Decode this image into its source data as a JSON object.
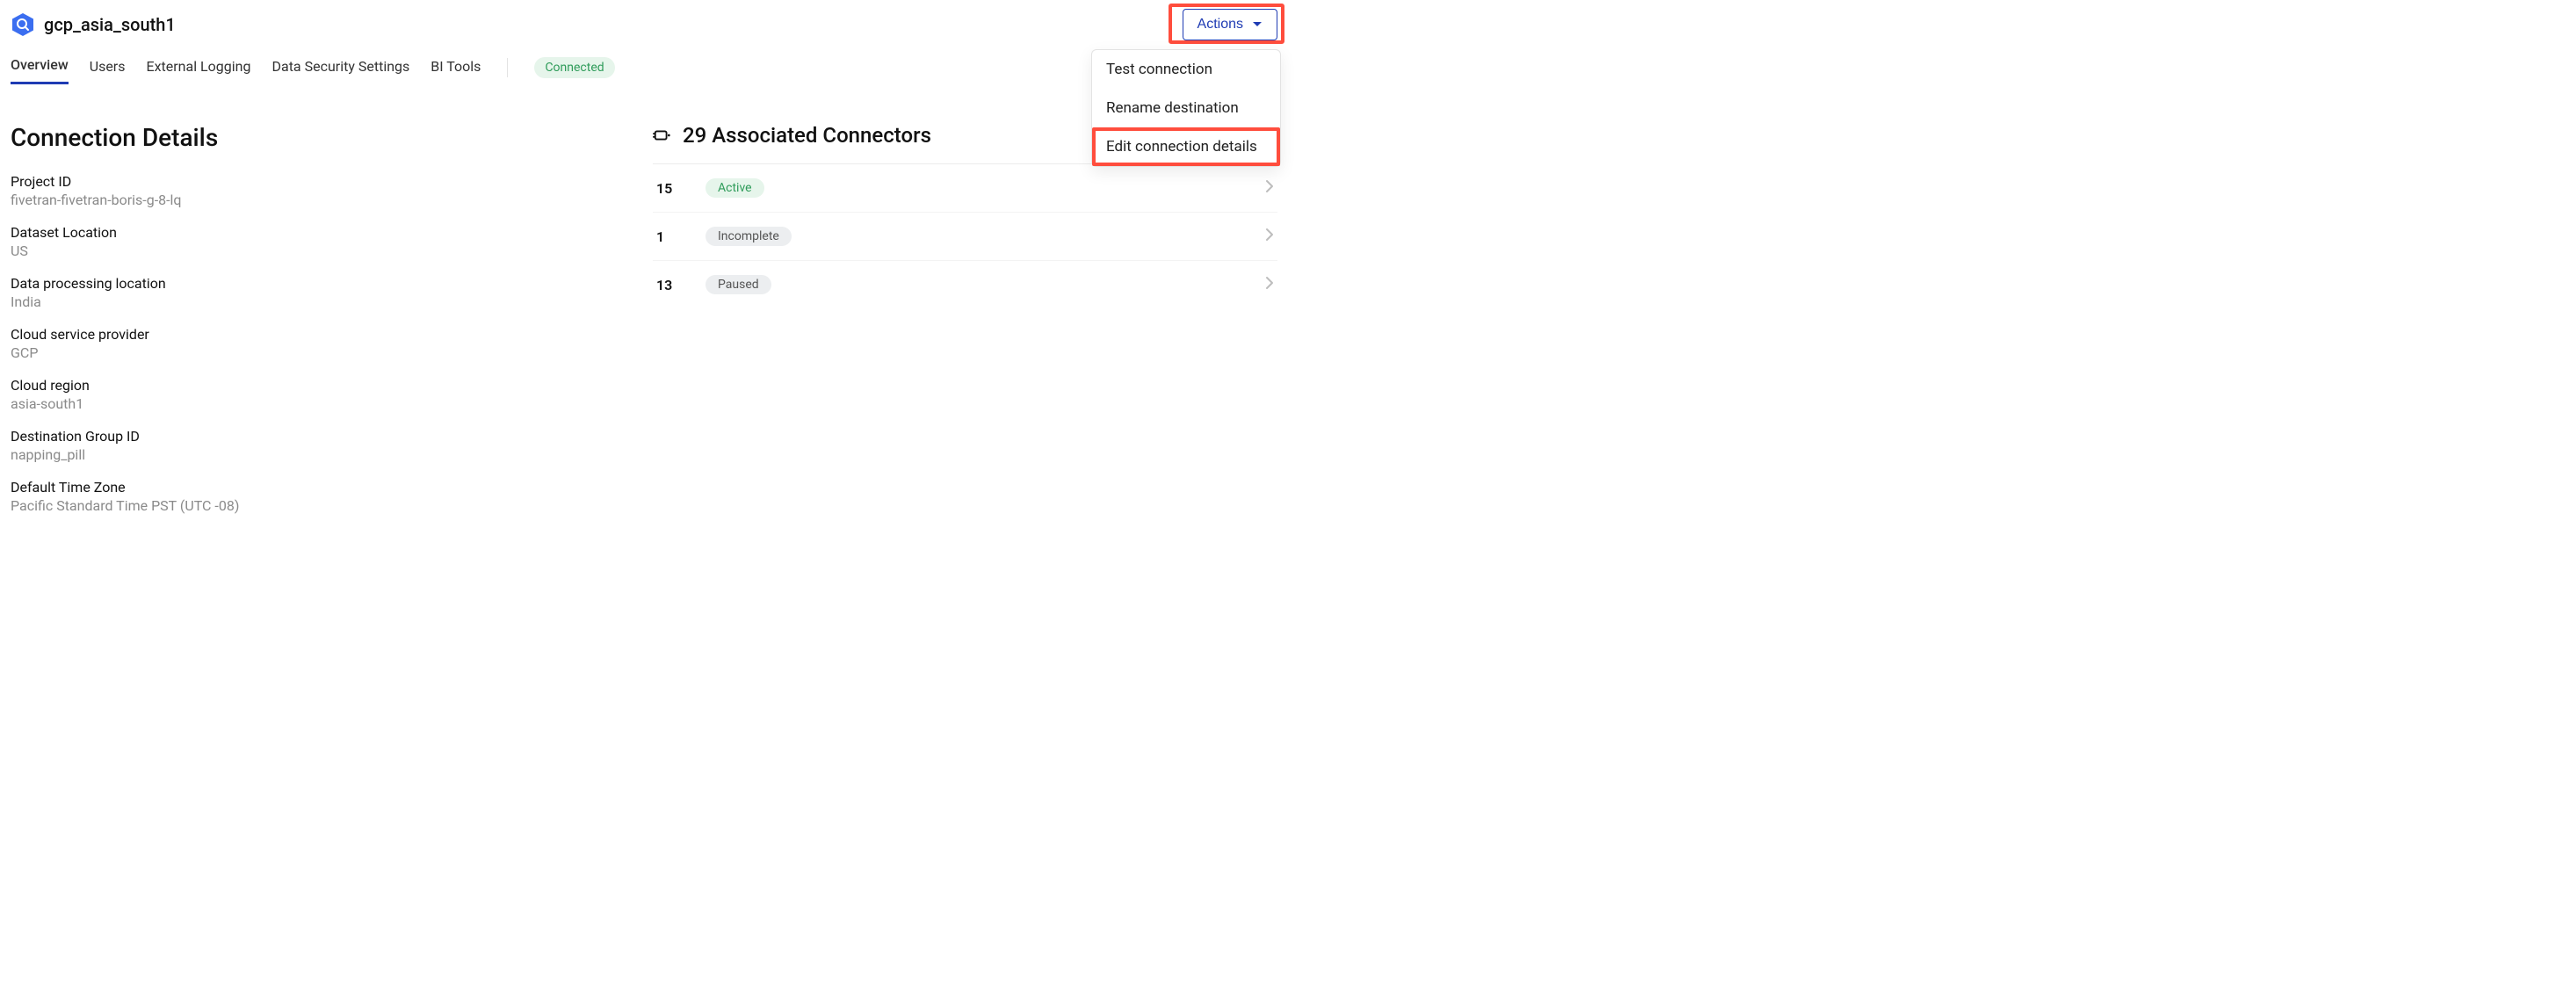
{
  "header": {
    "title": "gcp_asia_south1",
    "actions_label": "Actions"
  },
  "tabs": [
    {
      "label": "Overview",
      "active": true
    },
    {
      "label": "Users",
      "active": false
    },
    {
      "label": "External Logging",
      "active": false
    },
    {
      "label": "Data Security Settings",
      "active": false
    },
    {
      "label": "BI Tools",
      "active": false
    }
  ],
  "status": "Connected",
  "connection_details": {
    "title": "Connection Details",
    "fields": [
      {
        "label": "Project ID",
        "value": "fivetran-fivetran-boris-g-8-lq"
      },
      {
        "label": "Dataset Location",
        "value": "US"
      },
      {
        "label": "Data processing location",
        "value": "India"
      },
      {
        "label": "Cloud service provider",
        "value": "GCP"
      },
      {
        "label": "Cloud region",
        "value": "asia-south1"
      },
      {
        "label": "Destination Group ID",
        "value": "napping_pill"
      },
      {
        "label": "Default Time Zone",
        "value": "Pacific Standard Time PST (UTC -08)"
      }
    ]
  },
  "associated": {
    "title": "29 Associated Connectors",
    "rows": [
      {
        "count": "15",
        "status_label": "Active",
        "status_class": "active"
      },
      {
        "count": "1",
        "status_label": "Incomplete",
        "status_class": "incomplete"
      },
      {
        "count": "13",
        "status_label": "Paused",
        "status_class": "paused"
      }
    ]
  },
  "dropdown": {
    "items": [
      {
        "label": "Test connection",
        "highlighted": false
      },
      {
        "label": "Rename destination",
        "highlighted": false
      },
      {
        "label": "Edit connection details",
        "highlighted": true
      }
    ]
  }
}
